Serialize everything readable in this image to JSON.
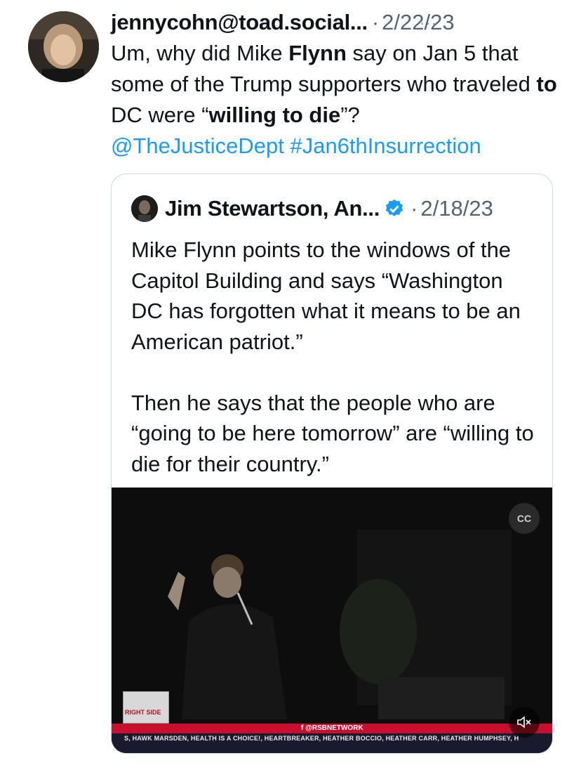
{
  "tweet": {
    "handle": "jennycohn@toad.social...",
    "separator": "·",
    "date": "2/22/23",
    "more": "···",
    "body_parts": [
      {
        "text": "Um, why did Mike ",
        "bold": false
      },
      {
        "text": "Flynn",
        "bold": true
      },
      {
        "text": " say on Jan 5 that some of the Trump supporters who traveled ",
        "bold": false
      },
      {
        "text": "to",
        "bold": true
      },
      {
        "text": " DC were “",
        "bold": false
      },
      {
        "text": "willing to die",
        "bold": true
      },
      {
        "text": "”?",
        "bold": false
      }
    ],
    "mention": "@TheJusticeDept",
    "hashtag": "#Jan6thInsurrection"
  },
  "quote": {
    "name": "Jim Stewartson, An...",
    "separator": "·",
    "date": "2/18/23",
    "paragraph1": "Mike Flynn points to the windows of the Capitol Building and says “Washington DC has forgotten what it means to be an American patriot.”",
    "paragraph2": "Then he says that the people who are “going to be here tomorrow” are “willing to die for their country.”"
  },
  "video": {
    "cc_icon": "closed-captions-icon",
    "mute_icon": "muted-speaker-icon",
    "network_text": "f @RSBNETWORK",
    "ticker_text": "S, HAWK MARSDEN, HEALTH IS A CHOICE!, HEARTBREAKER, HEATHER BOCCIO, HEATHER CARR, HEATHER HUMPHSEY, H",
    "logo_text": "RIGHT SIDE"
  },
  "colors": {
    "link": "#1d9bf0",
    "muted": "#536471",
    "border": "#cfd9de",
    "verified": "#1d9bf0",
    "ticker_red": "#c8102e"
  }
}
